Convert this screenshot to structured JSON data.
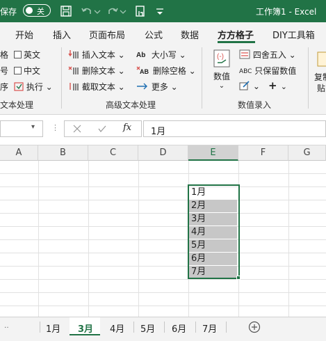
{
  "titlebar": {
    "autosave_label": "保存",
    "autosave_state": "关",
    "doc_title": "工作簿1  -  Excel"
  },
  "tabs": [
    "开始",
    "插入",
    "页面布局",
    "公式",
    "数据",
    "方方格子",
    "DIY工具箱"
  ],
  "active_tab": "方方格子",
  "ribbon": {
    "left_fragments": [
      "格",
      "号",
      "序"
    ],
    "checkboxes": [
      "英文",
      "中文"
    ],
    "execute_label": "执行",
    "group1_label": "文本处理",
    "text_tools": [
      "插入文本",
      "删除文本",
      "截取文本"
    ],
    "case_tools": [
      "大小写",
      "删除空格",
      "更多"
    ],
    "group2_label": "高级文本处理",
    "numeric_label": "数值",
    "round_label": "四舍五入",
    "keep_value_label": "只保留数值",
    "group3_label": "数值录入",
    "right_fragment_1": "复制",
    "right_fragment_2": "贴"
  },
  "formula_bar": {
    "fx_label": "fx",
    "cancel_icon": "close-icon",
    "enter_icon": "check-icon",
    "value": "1月"
  },
  "grid": {
    "columns": [
      "A",
      "B",
      "C",
      "D",
      "E",
      "F",
      "G"
    ],
    "selected_column": "E",
    "cells": [
      "1月",
      "2月",
      "3月",
      "4月",
      "5月",
      "6月",
      "7月"
    ]
  },
  "sheets": [
    "1月",
    "3月",
    "4月",
    "5月",
    "6月",
    "7月"
  ],
  "active_sheet": "3月",
  "add_sheet_icon": "plus-circle-icon",
  "colors": {
    "brand": "#217346",
    "highlight": "#c7c7c7"
  }
}
